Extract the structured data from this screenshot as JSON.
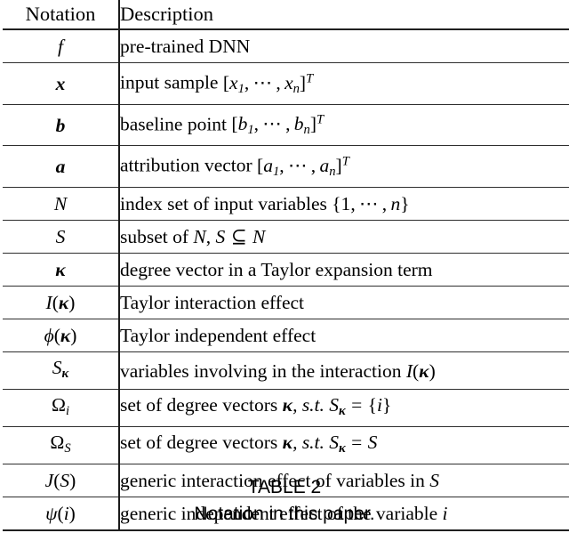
{
  "table": {
    "headers": {
      "notation": "Notation",
      "description": "Description"
    },
    "rows": [
      {
        "notation_plain": "f",
        "description_plain": "pre-trained DNN"
      },
      {
        "notation_plain": "x",
        "description_plain": "input sample [x1, ... , xn]^T"
      },
      {
        "notation_plain": "b",
        "description_plain": "baseline point [b1, ... , bn]^T"
      },
      {
        "notation_plain": "a",
        "description_plain": "attribution vector [a1, ... , an]^T"
      },
      {
        "notation_plain": "N",
        "description_plain": "index set of input variables {1, ... , n}"
      },
      {
        "notation_plain": "S",
        "description_plain": "subset of N, S ⊆ N"
      },
      {
        "notation_plain": "κ",
        "description_plain": "degree vector in a Taylor expansion term"
      },
      {
        "notation_plain": "I(κ)",
        "description_plain": "Taylor interaction effect"
      },
      {
        "notation_plain": "φ(κ)",
        "description_plain": "Taylor independent effect"
      },
      {
        "notation_plain": "S_κ",
        "description_plain": "variables involving in the interaction I(κ)"
      },
      {
        "notation_plain": "Ω_i",
        "description_plain": "set of degree vectors κ, s.t. S_κ = {i}"
      },
      {
        "notation_plain": "Ω_S",
        "description_plain": "set of degree vectors κ, s.t. S_κ = S"
      },
      {
        "notation_plain": "J(S)",
        "description_plain": "generic interaction effect of variables in S"
      },
      {
        "notation_plain": "ψ(i)",
        "description_plain": "generic independent effect of the variable i"
      }
    ]
  },
  "caption": {
    "label": "TABLE 2",
    "text": "Notation in this paper."
  }
}
